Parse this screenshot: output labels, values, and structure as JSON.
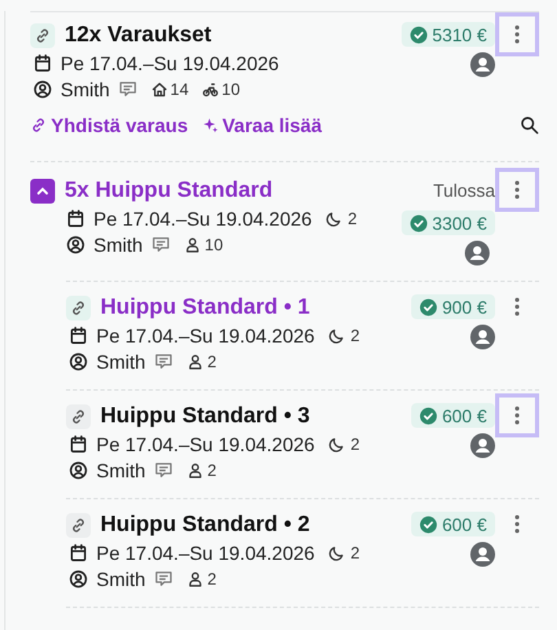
{
  "summary": {
    "title": "12x Varaukset",
    "selected": false,
    "dates": "Pe 17.04.–Su 19.04.2026",
    "guest": "Smith",
    "has_comment": true,
    "price": "5310 €",
    "paid": true,
    "menu_highlighted": true,
    "rooms": "14",
    "bikes": "10"
  },
  "actions": [
    {
      "kind": "link",
      "label": "Yhdistä varaus"
    },
    {
      "kind": "sparkle",
      "label": "Varaa lisää"
    }
  ],
  "groups": [
    {
      "title": "5x Huippu Standard",
      "expanded": true,
      "status": "Tulossa",
      "dates": "Pe 17.04.–Su 19.04.2026",
      "guest": "Smith",
      "has_comment": true,
      "price": "3300 €",
      "paid": true,
      "menu_highlighted": true,
      "nights": "2",
      "guests": "10",
      "children": [
        {
          "title": "Huippu Standard • 1",
          "selected": true,
          "dates": "Pe 17.04.–Su 19.04.2026",
          "guest": "Smith",
          "has_comment": true,
          "price": "900 €",
          "paid": true,
          "menu_highlighted": false,
          "nights": "2",
          "guests": "2"
        },
        {
          "title": "Huippu Standard • 3",
          "selected": false,
          "dates": "Pe 17.04.–Su 19.04.2026",
          "guest": "Smith",
          "has_comment": true,
          "price": "600 €",
          "paid": true,
          "menu_highlighted": true,
          "nights": "2",
          "guests": "2"
        },
        {
          "title": "Huippu Standard • 2",
          "selected": false,
          "dates": "Pe 17.04.–Su 19.04.2026",
          "guest": "Smith",
          "has_comment": true,
          "price": "600 €",
          "paid": true,
          "menu_highlighted": false,
          "nights": "2",
          "guests": "2"
        }
      ]
    }
  ]
}
